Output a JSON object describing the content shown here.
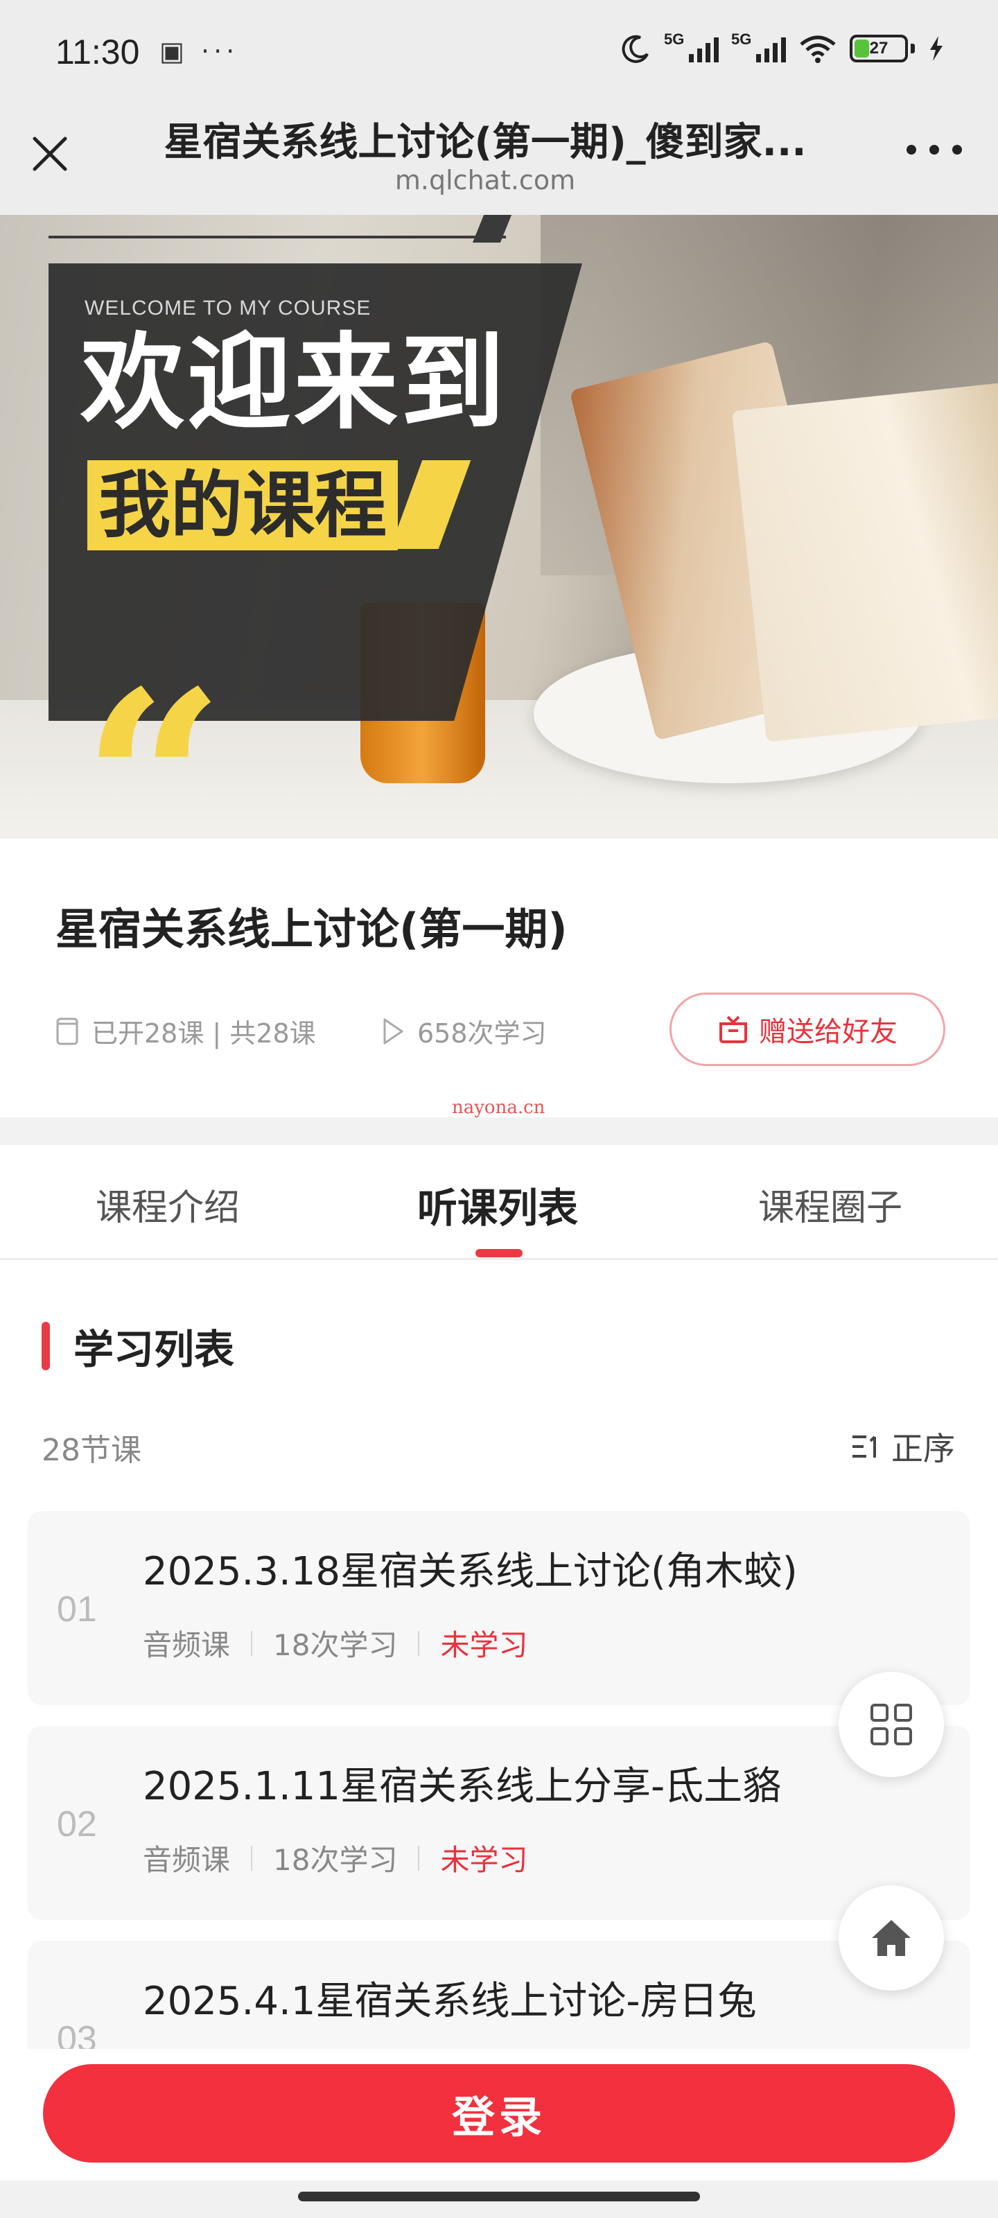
{
  "status_bar": {
    "time": "11:30",
    "left_icons": [
      "sim-card-icon",
      "more-dots"
    ],
    "sim1_label": "5G",
    "sim2_label": "5G",
    "battery_level": "27"
  },
  "nav": {
    "title": "星宿关系线上讨论(第一期)_傻到家...",
    "url": "m.qlchat.com"
  },
  "banner": {
    "welcome": "WELCOME TO MY COURSE",
    "headline": "欢迎来到",
    "subheadline": "我的课程",
    "quote_mark": "“"
  },
  "course": {
    "title": "星宿关系线上讨论(第一期)",
    "lessons_info": "已开28课 | 共28课",
    "plays_info": "658次学习",
    "gift_label": "赠送给好友"
  },
  "watermark": "nayona.cn",
  "tabs": [
    {
      "label": "课程介绍",
      "active": false
    },
    {
      "label": "听课列表",
      "active": true
    },
    {
      "label": "课程圈子",
      "active": false
    }
  ],
  "list": {
    "section_title": "学习列表",
    "count_label": "28节课",
    "sort_label": "正序",
    "lessons": [
      {
        "num": "01",
        "title": "2025.3.18星宿关系线上讨论(角木蛟)",
        "type": "音频课",
        "plays": "18次学习",
        "status": "未学习"
      },
      {
        "num": "02",
        "title": "2025.1.11星宿关系线上分享-氐土貉",
        "type": "音频课",
        "plays": "18次学习",
        "status": "未学习"
      },
      {
        "num": "03",
        "title": "2025.4.1星宿关系线上讨论-房日兔",
        "type": "",
        "plays": "",
        "status": ""
      }
    ]
  },
  "bottom": {
    "login_label": "登录"
  },
  "colors": {
    "accent": "#f2303e",
    "status_red": "#e8323c",
    "banner_yellow": "#f5d547"
  }
}
